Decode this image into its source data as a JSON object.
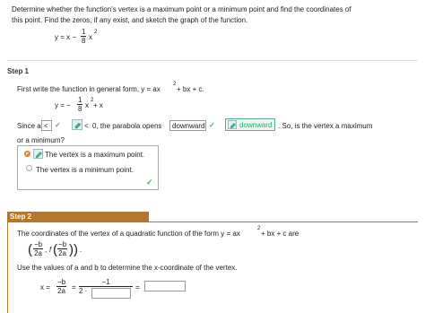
{
  "problem": {
    "line1": "Determine whether the function's vertex is a maximum point or a minimum point and find the coordinates of",
    "line2": "this point. Find the zeros, if any exist, and sketch the graph of the function.",
    "eq_lhs": "y = x −",
    "eq_num": "1",
    "eq_den": "8",
    "eq_rhs": "x",
    "eq_exp": "2"
  },
  "step1": {
    "header": "Step 1",
    "intro": "First write the function in general form, y = ax",
    "intro_exp": "2",
    "intro_tail": " + bx + c.",
    "eq_lhs": "y = −",
    "eq_num": "1",
    "eq_den": "8",
    "eq_x": "x",
    "eq_exp": "2",
    "eq_tail": " + x",
    "since_a": "Since a",
    "lt_symbol": "<",
    "zero_text": "0, the parabola opens",
    "opens_value": "downward",
    "opens_answer": "downward",
    "question_tail": ". So, is the vertex a maximum",
    "question_line2": "or a minimum?",
    "options": [
      "The vertex is a maximum point.",
      "The vertex is a minimum point."
    ],
    "selected_index": 0
  },
  "step2": {
    "header": "Step 2",
    "line1": "The coordinates of the vertex of a quadratic function of the form y = ax",
    "line1_exp": "2",
    "line1_tail": " + bx + c are",
    "vertex_num1": "−b",
    "vertex_den1": "2a",
    "vertex_f": "f",
    "vertex_num2": "−b",
    "vertex_den2": "2a",
    "line2": "Use the values of a and b to determine the x-coordinate of the vertex.",
    "x_eq": "x =",
    "x_num": "−b",
    "x_den": "2a",
    "eq_sign": "=",
    "x_num2": "−1",
    "x_den2": "2 ·",
    "eq_sign2": "="
  }
}
